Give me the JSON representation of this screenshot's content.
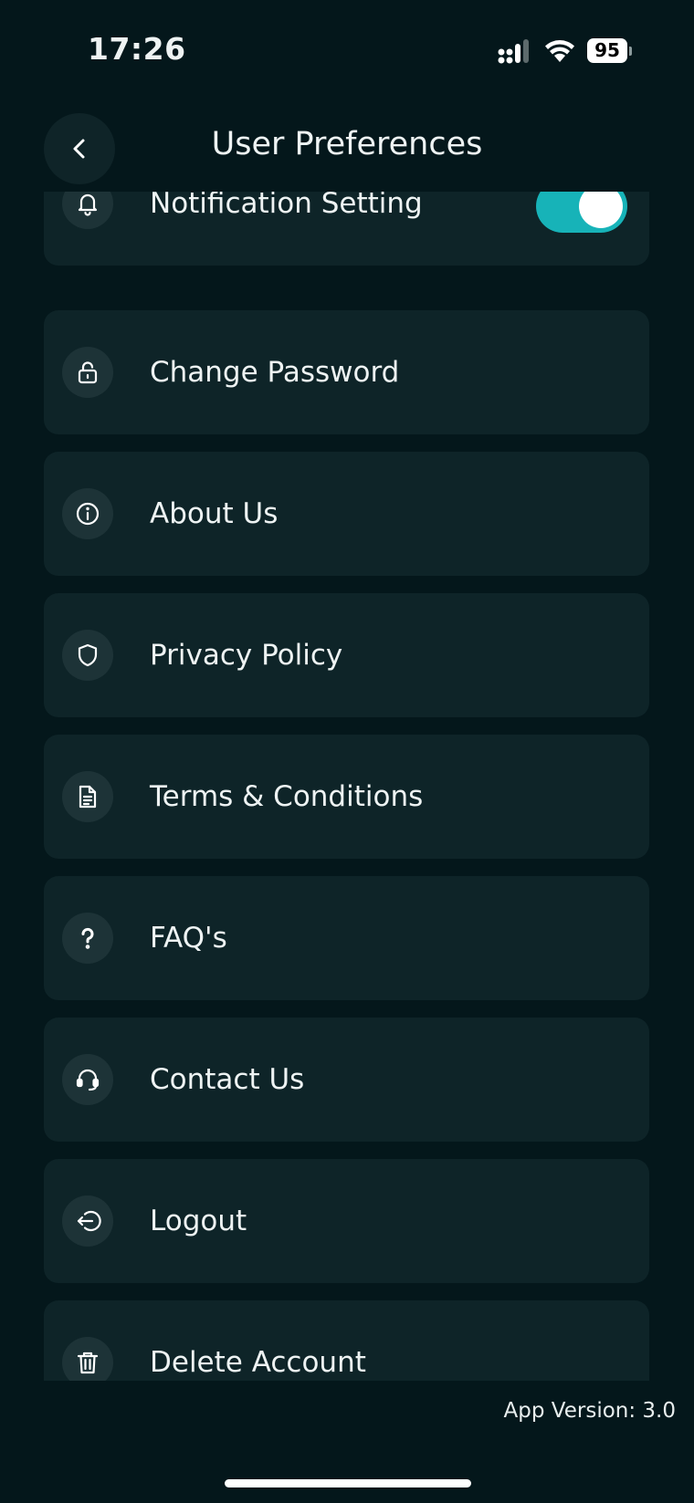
{
  "status_bar": {
    "time": "17:26",
    "battery": "95"
  },
  "header": {
    "title": "User Preferences"
  },
  "menu": {
    "items": [
      {
        "label": "Notification Setting",
        "icon": "bell-icon",
        "toggle_on": true
      },
      {
        "label": "Change Password",
        "icon": "lock-icon"
      },
      {
        "label": "About Us",
        "icon": "info-icon"
      },
      {
        "label": "Privacy Policy",
        "icon": "shield-icon"
      },
      {
        "label": "Terms & Conditions",
        "icon": "document-icon"
      },
      {
        "label": "FAQ's",
        "icon": "question-icon"
      },
      {
        "label": "Contact Us",
        "icon": "headset-icon"
      },
      {
        "label": "Logout",
        "icon": "logout-icon"
      },
      {
        "label": "Delete Account",
        "icon": "trash-icon"
      }
    ]
  },
  "footer": {
    "app_version": "App Version: 3.0"
  },
  "colors": {
    "background": "#04171b",
    "card": "#0e2428",
    "accent": "#17b3b8"
  }
}
